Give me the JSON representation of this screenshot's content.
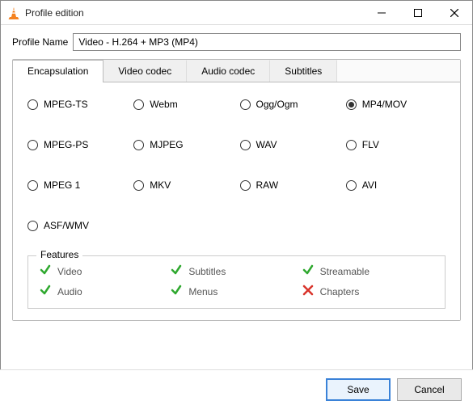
{
  "window": {
    "title": "Profile edition"
  },
  "profile": {
    "label": "Profile Name",
    "value": "Video - H.264 + MP3 (MP4)"
  },
  "tabs": [
    {
      "label": "Encapsulation"
    },
    {
      "label": "Video codec"
    },
    {
      "label": "Audio codec"
    },
    {
      "label": "Subtitles"
    }
  ],
  "active_tab": 0,
  "encapsulation": {
    "options": [
      {
        "label": "MPEG-TS",
        "selected": false
      },
      {
        "label": "Webm",
        "selected": false
      },
      {
        "label": "Ogg/Ogm",
        "selected": false
      },
      {
        "label": "MP4/MOV",
        "selected": true
      },
      {
        "label": "MPEG-PS",
        "selected": false
      },
      {
        "label": "MJPEG",
        "selected": false
      },
      {
        "label": "WAV",
        "selected": false
      },
      {
        "label": "FLV",
        "selected": false
      },
      {
        "label": "MPEG 1",
        "selected": false
      },
      {
        "label": "MKV",
        "selected": false
      },
      {
        "label": "RAW",
        "selected": false
      },
      {
        "label": "AVI",
        "selected": false
      },
      {
        "label": "ASF/WMV",
        "selected": false
      }
    ]
  },
  "features": {
    "title": "Features",
    "items": [
      {
        "label": "Video",
        "ok": true
      },
      {
        "label": "Subtitles",
        "ok": true
      },
      {
        "label": "Streamable",
        "ok": true
      },
      {
        "label": "Audio",
        "ok": true
      },
      {
        "label": "Menus",
        "ok": true
      },
      {
        "label": "Chapters",
        "ok": false
      }
    ]
  },
  "buttons": {
    "save": "Save",
    "cancel": "Cancel"
  }
}
